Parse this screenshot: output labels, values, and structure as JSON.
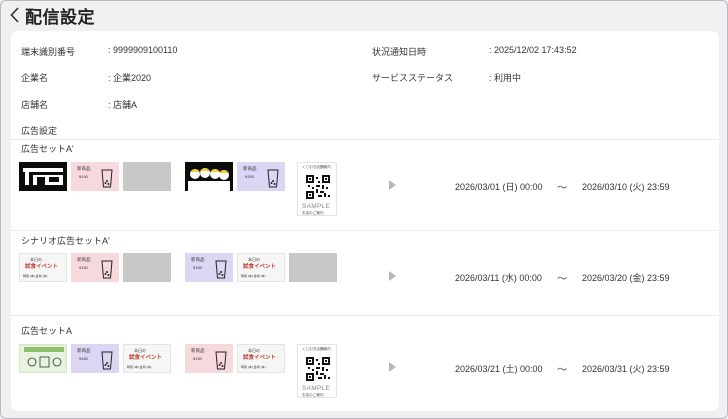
{
  "header": {
    "title": "配信設定"
  },
  "info": {
    "terminal_id_label": "端末識別番号",
    "terminal_id_value": ": 9999909100110",
    "status_time_label": "状況通知日時",
    "status_time_value": ": 2025/12/02 17:43:52",
    "company_label": "企業名",
    "company_value": ": 企業2020",
    "service_status_label": "サービスステータス",
    "service_status_value": ": 利用中",
    "store_label": "店舗名",
    "store_value": ": 店舗A"
  },
  "ad_settings_label": "広告設定",
  "thumb_text": {
    "new_product": "新商品",
    "price": "¥150",
    "today_only": "本日の",
    "event": "試食イベント",
    "event_note": "時間 (本) 会場 (本)",
    "qr_heading": "くじ引き店舗案内",
    "qr_sample": "SAMPLE",
    "qr_footer": "お店のご案内"
  },
  "ad_sets": [
    {
      "name": "広告セットA'",
      "start": "2026/03/01 (日) 00:00",
      "tilde": "～",
      "end": "2026/03/10 (火) 23:59"
    },
    {
      "name": "シナリオ広告セットA'",
      "start": "2026/03/11 (水) 00:00",
      "tilde": "～",
      "end": "2026/03/20 (金) 23:59"
    },
    {
      "name": "広告セットA",
      "start": "2026/03/21 (土) 00:00",
      "tilde": "～",
      "end": "2026/03/31 (火) 23:59"
    }
  ],
  "colors": {
    "background": "#f0f0f2",
    "card": "#ffffff",
    "pink_thumb": "#f7d9dd",
    "lavender_thumb": "#dcd6f4",
    "placeholder_thumb": "#c8c8c8",
    "arrow": "#b7b7b7"
  },
  "icons": {
    "back": "chevron-left-icon",
    "play": "play-triangle-icon"
  }
}
